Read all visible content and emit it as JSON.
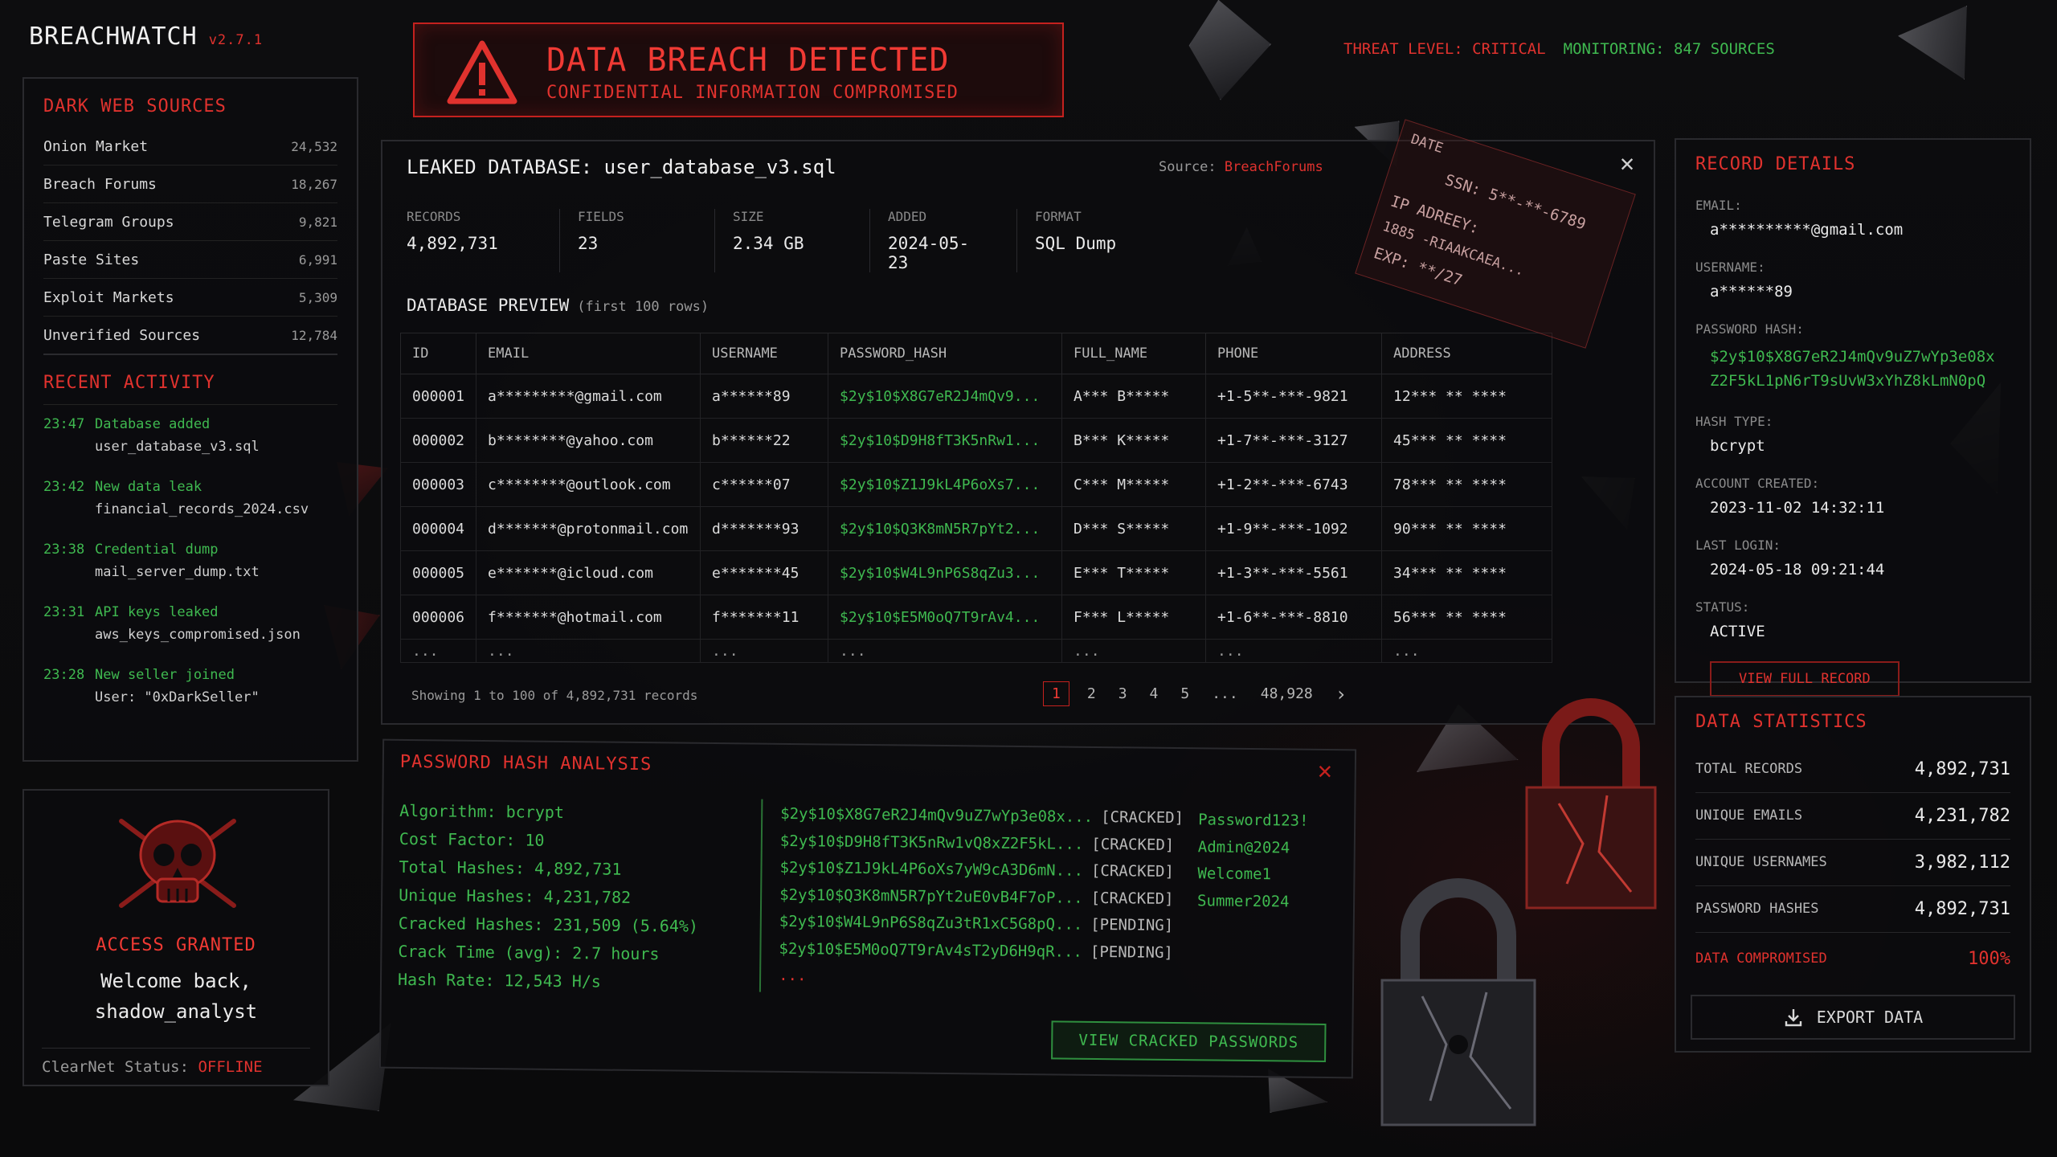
{
  "app": {
    "name": "BREACHWATCH",
    "version": "v2.7.1"
  },
  "alert": {
    "title": "DATA BREACH DETECTED",
    "subtitle": "CONFIDENTIAL INFORMATION COMPROMISED"
  },
  "status_bar": {
    "threat": "THREAT LEVEL: CRITICAL",
    "monitoring": "MONITORING: 847 SOURCES"
  },
  "sources": {
    "title": "DARK WEB SOURCES",
    "items": [
      {
        "label": "Onion Market",
        "count": "24,532"
      },
      {
        "label": "Breach Forums",
        "count": "18,267"
      },
      {
        "label": "Telegram Groups",
        "count": "9,821"
      },
      {
        "label": "Paste Sites",
        "count": "6,991"
      },
      {
        "label": "Exploit Markets",
        "count": "5,309"
      },
      {
        "label": "Unverified Sources",
        "count": "12,784"
      }
    ]
  },
  "activity": {
    "title": "RECENT ACTIVITY",
    "items": [
      {
        "time": "23:47",
        "event": "Database added",
        "detail": "user_database_v3.sql"
      },
      {
        "time": "23:42",
        "event": "New data leak",
        "detail": "financial_records_2024.csv"
      },
      {
        "time": "23:38",
        "event": "Credential dump",
        "detail": "mail_server_dump.txt"
      },
      {
        "time": "23:31",
        "event": "API keys leaked",
        "detail": "aws_keys_compromised.json"
      },
      {
        "time": "23:28",
        "event": "New seller joined",
        "detail": "User: \"0xDarkSeller\""
      }
    ]
  },
  "access": {
    "status": "ACCESS GRANTED",
    "welcome_line1": "Welcome back,",
    "welcome_line2": "shadow_analyst",
    "clearnet_label": "ClearNet Status:",
    "clearnet_value": "OFFLINE"
  },
  "database": {
    "title": "LEAKED DATABASE: user_database_v3.sql",
    "source_label": "Source:",
    "source_value": "BreachForums",
    "stats": [
      {
        "key": "RECORDS",
        "value": "4,892,731"
      },
      {
        "key": "FIELDS",
        "value": "23"
      },
      {
        "key": "SIZE",
        "value": "2.34 GB"
      },
      {
        "key": "ADDED",
        "value": "2024-05-23"
      },
      {
        "key": "FORMAT",
        "value": "SQL Dump"
      }
    ],
    "preview_title": "DATABASE PREVIEW",
    "preview_sub": "(first 100 rows)",
    "columns": [
      "ID",
      "EMAIL",
      "USERNAME",
      "PASSWORD_HASH",
      "FULL_NAME",
      "PHONE",
      "ADDRESS"
    ],
    "rows": [
      [
        "000001",
        "a*********@gmail.com",
        "a******89",
        "$2y$10$X8G7eR2J4mQv9...",
        "A*** B*****",
        "+1-5**-***-9821",
        "12*** ** ****"
      ],
      [
        "000002",
        "b********@yahoo.com",
        "b******22",
        "$2y$10$D9H8fT3K5nRw1...",
        "B*** K*****",
        "+1-7**-***-3127",
        "45*** ** ****"
      ],
      [
        "000003",
        "c********@outlook.com",
        "c******07",
        "$2y$10$Z1J9kL4P6oXs7...",
        "C*** M*****",
        "+1-2**-***-6743",
        "78*** ** ****"
      ],
      [
        "000004",
        "d*******@protonmail.com",
        "d*******93",
        "$2y$10$Q3K8mN5R7pYt2...",
        "D*** S*****",
        "+1-9**-***-1092",
        "90*** ** ****"
      ],
      [
        "000005",
        "e*******@icloud.com",
        "e*******45",
        "$2y$10$W4L9nP6S8qZu3...",
        "E*** T*****",
        "+1-3**-***-5561",
        "34*** ** ****"
      ],
      [
        "000006",
        "f*******@hotmail.com",
        "f*******11",
        "$2y$10$E5M0oQ7T9rAv4...",
        "F*** L*****",
        "+1-6**-***-8810",
        "56*** ** ****"
      ],
      [
        "...",
        "...",
        "...",
        "...",
        "...",
        "...",
        "..."
      ]
    ],
    "showing": "Showing 1 to 100 of 4,892,731 records",
    "pages": [
      "1",
      "2",
      "3",
      "4",
      "5",
      "...",
      "48,928"
    ],
    "next": "›"
  },
  "hash_analysis": {
    "title": "PASSWORD HASH ANALYSIS",
    "stats": [
      "Algorithm: bcrypt",
      "Cost Factor: 10",
      "Total Hashes: 4,892,731",
      "Unique Hashes: 4,231,782",
      "Cracked Hashes:  231,509 (5.64%)",
      "Crack Time (avg):  2.7 hours",
      "Hash Rate:  12,543 H/s"
    ],
    "hashes": [
      {
        "hash": "$2y$10$X8G7eR2J4mQv9uZ7wYp3e08x...",
        "status": "[CRACKED]",
        "plain": "Password123!"
      },
      {
        "hash": "$2y$10$D9H8fT3K5nRw1vQ8xZ2F5kL...",
        "status": "[CRACKED]",
        "plain": "Admin@2024"
      },
      {
        "hash": "$2y$10$Z1J9kL4P6oXs7yW9cA3D6mN...",
        "status": "[CRACKED]",
        "plain": "Welcome1"
      },
      {
        "hash": "$2y$10$Q3K8mN5R7pYt2uE0vB4F7oP...",
        "status": "[CRACKED]",
        "plain": "Summer2024"
      },
      {
        "hash": "$2y$10$W4L9nP6S8qZu3tR1xC5G8pQ...",
        "status": "[PENDING]",
        "plain": ""
      },
      {
        "hash": "$2y$10$E5M0oQ7T9rAv4sT2yD6H9qR...",
        "status": "[PENDING]",
        "plain": ""
      }
    ],
    "more": "...",
    "button": "VIEW CRACKED PASSWORDS"
  },
  "record": {
    "title": "RECORD DETAILS",
    "email_k": "EMAIL:",
    "email_v": "a**********@gmail.com",
    "username_k": "USERNAME:",
    "username_v": "a******89",
    "hash_k": "PASSWORD HASH:",
    "hash_v1": "$2y$10$X8G7eR2J4mQv9uZ7wYp3e08x",
    "hash_v2": "Z2F5kL1pN6rT9sUvW3xYhZ8kLmN0pQ",
    "type_k": "HASH TYPE:",
    "type_v": "bcrypt",
    "created_k": "ACCOUNT CREATED:",
    "created_v": "2023-11-02 14:32:11",
    "login_k": "LAST LOGIN:",
    "login_v": "2024-05-18 09:21:44",
    "status_k": "STATUS:",
    "status_v": "ACTIVE",
    "button": "VIEW FULL RECORD"
  },
  "data_stats": {
    "title": "DATA STATISTICS",
    "rows": [
      {
        "key": "TOTAL RECORDS",
        "value": "4,892,731"
      },
      {
        "key": "UNIQUE EMAILS",
        "value": "4,231,782"
      },
      {
        "key": "UNIQUE USERNAMES",
        "value": "3,982,112"
      },
      {
        "key": "PASSWORD HASHES",
        "value": "4,892,731"
      },
      {
        "key": "DATA COMPROMISED",
        "value": "100%"
      }
    ],
    "export": "EXPORT DATA"
  },
  "floating_card": {
    "date": "DATE",
    "ssn": "SSN: 5**-**-6789",
    "ip": "IP ADREEY:",
    "ipv": "1885 -RIAAKCAEA...",
    "exp": "EXP: **/27"
  }
}
